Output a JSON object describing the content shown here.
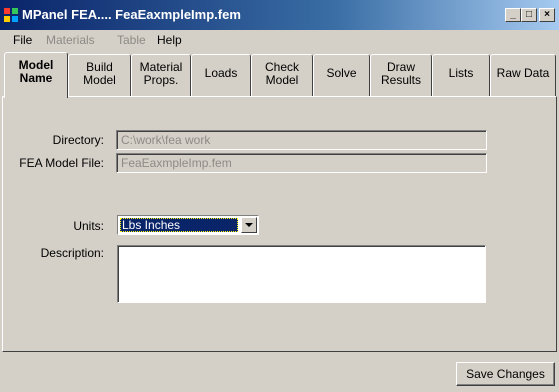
{
  "window": {
    "title": "MPanel FEA.... FeaEaxmpleImp.fem",
    "minimize_label": "_",
    "maximize_label": "□",
    "close_label": "×"
  },
  "menu": [
    {
      "label": "File",
      "enabled": true
    },
    {
      "label": "Materials",
      "enabled": false
    },
    {
      "label": "Table",
      "enabled": false
    },
    {
      "label": "Help",
      "enabled": true
    }
  ],
  "tabs": [
    {
      "line1": "Model",
      "line2": "Name",
      "active": true
    },
    {
      "line1": "Build",
      "line2": "Model"
    },
    {
      "line1": "Material",
      "line2": "Props."
    },
    {
      "line1": "Loads",
      "line2": ""
    },
    {
      "line1": "Check",
      "line2": "Model"
    },
    {
      "line1": "Solve",
      "line2": ""
    },
    {
      "line1": "Draw",
      "line2": "Results"
    },
    {
      "line1": "Lists",
      "line2": ""
    },
    {
      "line1": "Raw Data",
      "line2": ""
    }
  ],
  "form": {
    "directory_label": "Directory:",
    "directory_value": "C:\\work\\fea work",
    "model_file_label": "FEA Model File:",
    "model_file_value": "FeaEaxmpleImp.fem",
    "units_label": "Units:",
    "units_value": "Lbs Inches",
    "description_label": "Description:",
    "description_value": ""
  },
  "footer": {
    "save_label": "Save Changes"
  }
}
